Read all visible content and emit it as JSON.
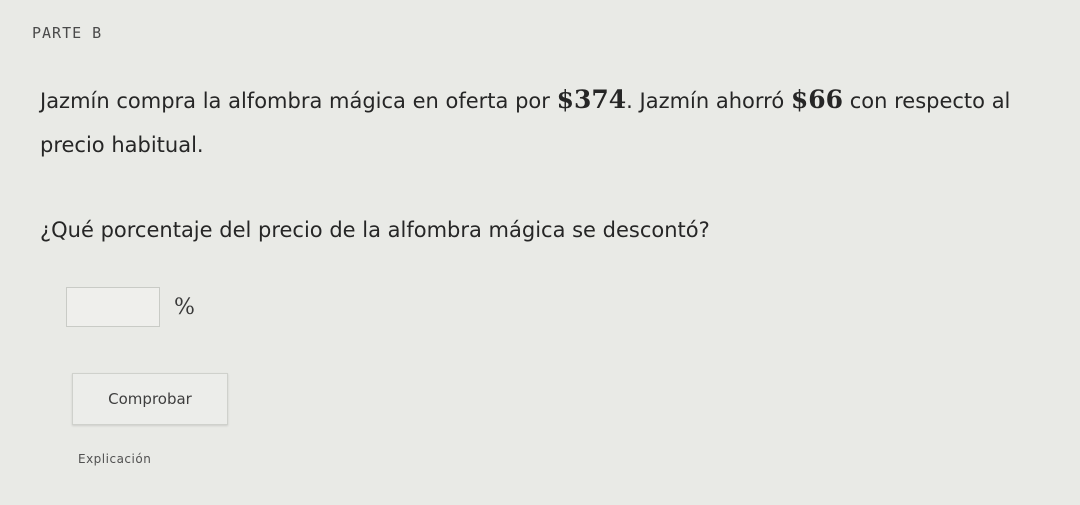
{
  "part": {
    "label": "PARTE B"
  },
  "problem": {
    "text_1": "Jazmín compra la alfombra mágica en oferta por ",
    "price": "$374",
    "text_2": ". Jazmín ahorró ",
    "savings": "$66",
    "text_3": " con respecto al precio habitual."
  },
  "question": {
    "text": "¿Qué porcentaje del precio de la alfombra mágica se descontó?"
  },
  "answer": {
    "value": "",
    "unit": "%"
  },
  "actions": {
    "check_label": "Comprobar",
    "explanation_label": "Explicación"
  }
}
